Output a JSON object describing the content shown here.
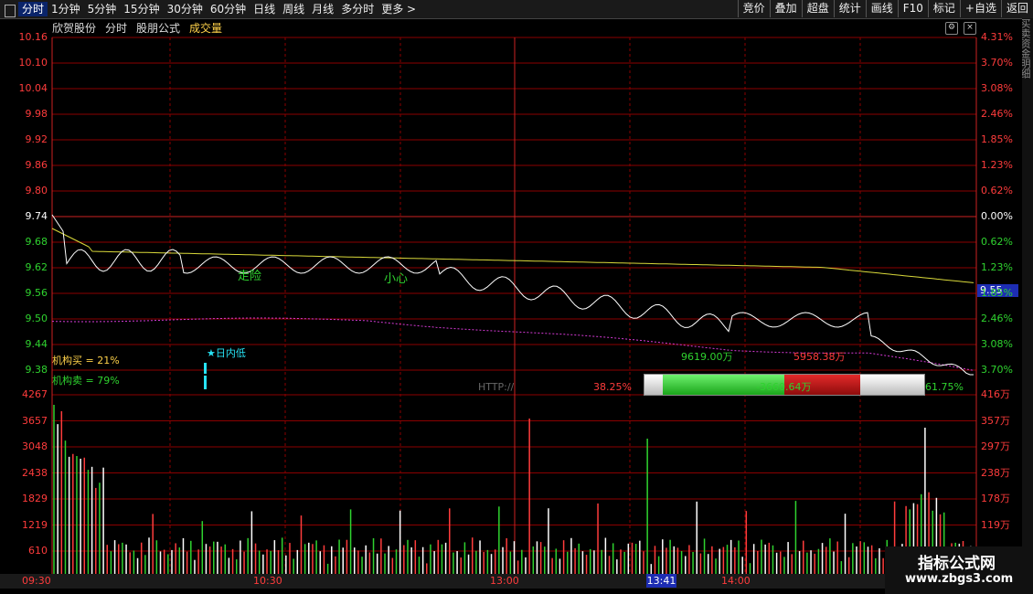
{
  "toolbar": {
    "left_items": [
      "分时",
      "1分钟",
      "5分钟",
      "15分钟",
      "30分钟",
      "60分钟",
      "日线",
      "周线",
      "月线",
      "多分时",
      "更多 >"
    ],
    "right_items": [
      "竞价",
      "叠加",
      "超盘",
      "统计",
      "画线",
      "F10",
      "标记",
      "+自选",
      "返回"
    ]
  },
  "header": {
    "stock_name": "欣贺股份",
    "mode": "分时",
    "formula": "股朋公式",
    "indicator": "成交量"
  },
  "price_axis": {
    "left": [
      "10.16",
      "10.10",
      "10.04",
      "9.98",
      "9.92",
      "9.86",
      "9.80",
      "9.74",
      "9.68",
      "9.62",
      "9.56",
      "9.50",
      "9.44",
      "9.38"
    ],
    "right": [
      "4.31%",
      "3.70%",
      "3.08%",
      "2.46%",
      "1.85%",
      "1.23%",
      "0.62%",
      "0.00%",
      "0.62%",
      "1.23%",
      "1.85%",
      "2.46%",
      "3.08%",
      "3.70%"
    ]
  },
  "volume_axis": {
    "left": [
      "4267",
      "3657",
      "3048",
      "2438",
      "1829",
      "1219",
      "610"
    ],
    "right": [
      "416万",
      "357万",
      "297万",
      "238万",
      "178万",
      "119万"
    ]
  },
  "time_axis": [
    "09:30",
    "10:30",
    "13:00",
    "14:00"
  ],
  "current_time": "13:41",
  "current_price": "9.55",
  "annotations": {
    "warn1": "走险",
    "warn2": "小心",
    "day_low": "★日内低",
    "inst_buy": "机构买 = 21%",
    "inst_sell": "机构卖 = 79%",
    "http": "HTTP://",
    "pct_left": "38.25%",
    "value_a": "9619.00万",
    "value_b": "5958.38万",
    "value_c": "-3660.64万",
    "pct_right": "61.75%"
  },
  "bar_widget": {
    "green": 38.25,
    "red": 61.75
  },
  "colors": {
    "price_line": "#ffffff",
    "avg_line": "#d9d93a",
    "pink_line": "#d63ad6",
    "grid": "#8b0000",
    "buy": "#2fd32f",
    "sell": "#ff3c3c"
  },
  "watermark": {
    "title": "指标公式网",
    "url": "www.zbgs3.com"
  },
  "chart_data": {
    "type": "line",
    "series": [],
    "ylim": [
      9.38,
      10.16
    ],
    "volume_ylim": [
      0,
      4267
    ],
    "grid": true
  }
}
